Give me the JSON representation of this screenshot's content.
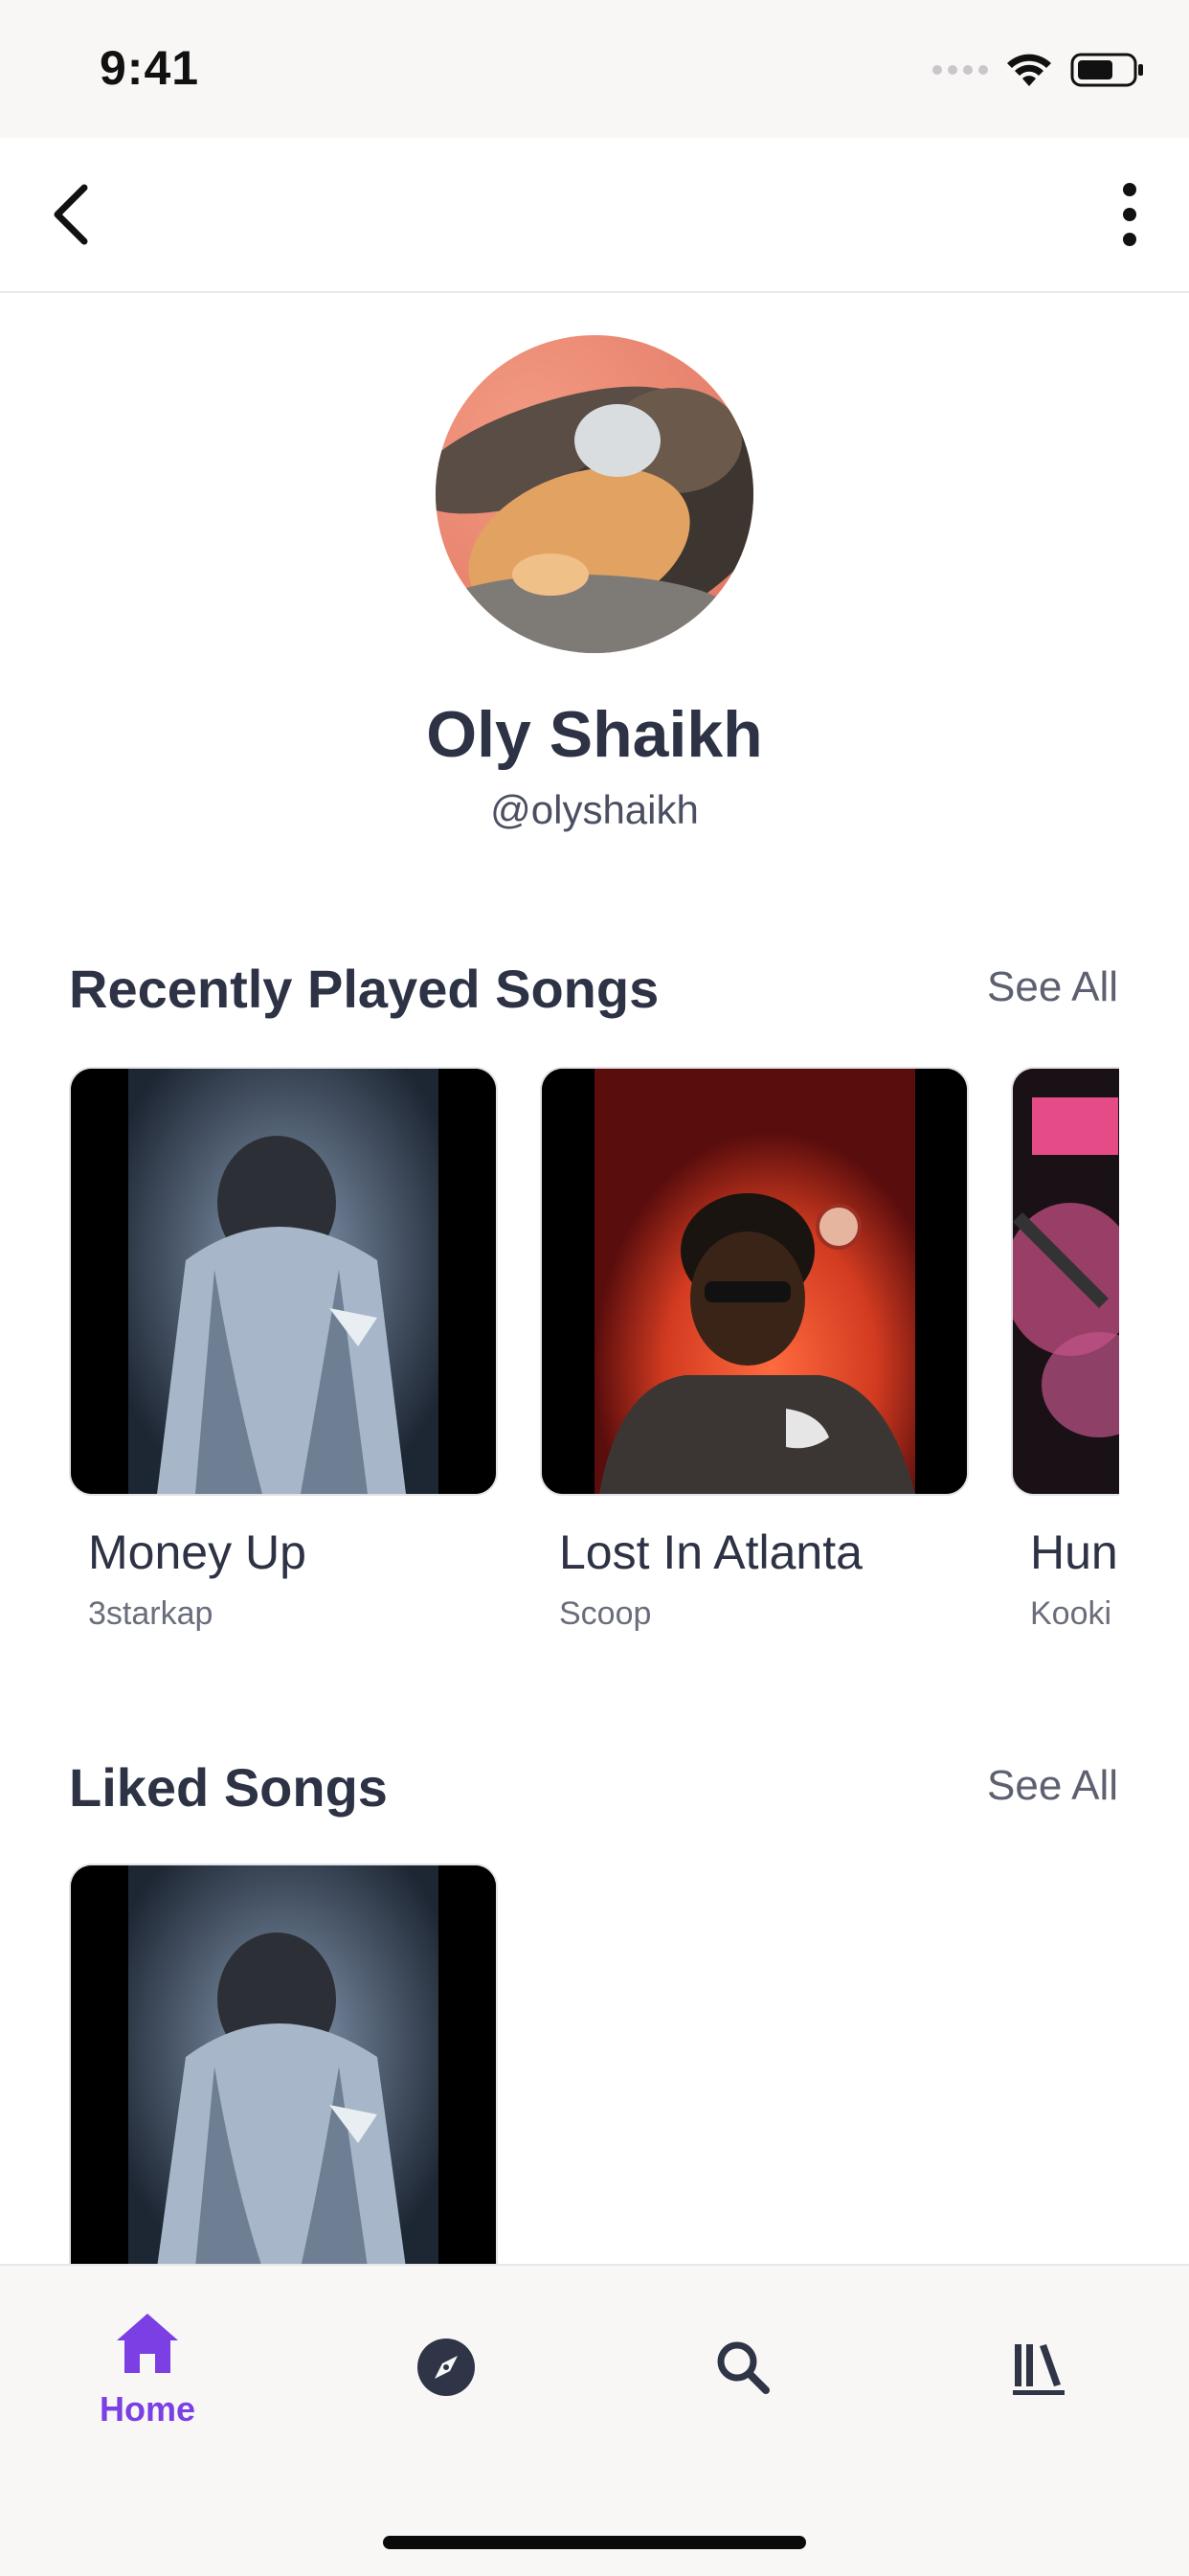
{
  "status_bar": {
    "time": "9:41"
  },
  "top_nav": {
    "back_icon": "chevron-left-icon",
    "more_icon": "more-vertical-icon"
  },
  "profile": {
    "name": "Oly Shaikh",
    "handle": "@olyshaikh",
    "avatar_icon": "cats-photo"
  },
  "recently_played": {
    "title": "Recently Played Songs",
    "see_all": "See All",
    "songs": [
      {
        "title": "Money Up",
        "artist": "3starkap"
      },
      {
        "title": "Lost In Atlanta",
        "artist": "Scoop"
      },
      {
        "title": "Hun",
        "artist": "Kooki"
      }
    ]
  },
  "liked_songs": {
    "title": "Liked Songs",
    "see_all": "See All"
  },
  "tab_bar": {
    "tabs": [
      {
        "label": "Home",
        "icon": "home-icon",
        "active": true
      },
      {
        "label": "",
        "icon": "compass-icon",
        "active": false
      },
      {
        "label": "",
        "icon": "search-icon",
        "active": false
      },
      {
        "label": "",
        "icon": "library-icon",
        "active": false
      }
    ]
  },
  "colors": {
    "accent": "#7b3fe4",
    "text_primary": "#2d3245",
    "text_secondary": "#6a6e7c",
    "bar_background": "#f8f7f6"
  }
}
